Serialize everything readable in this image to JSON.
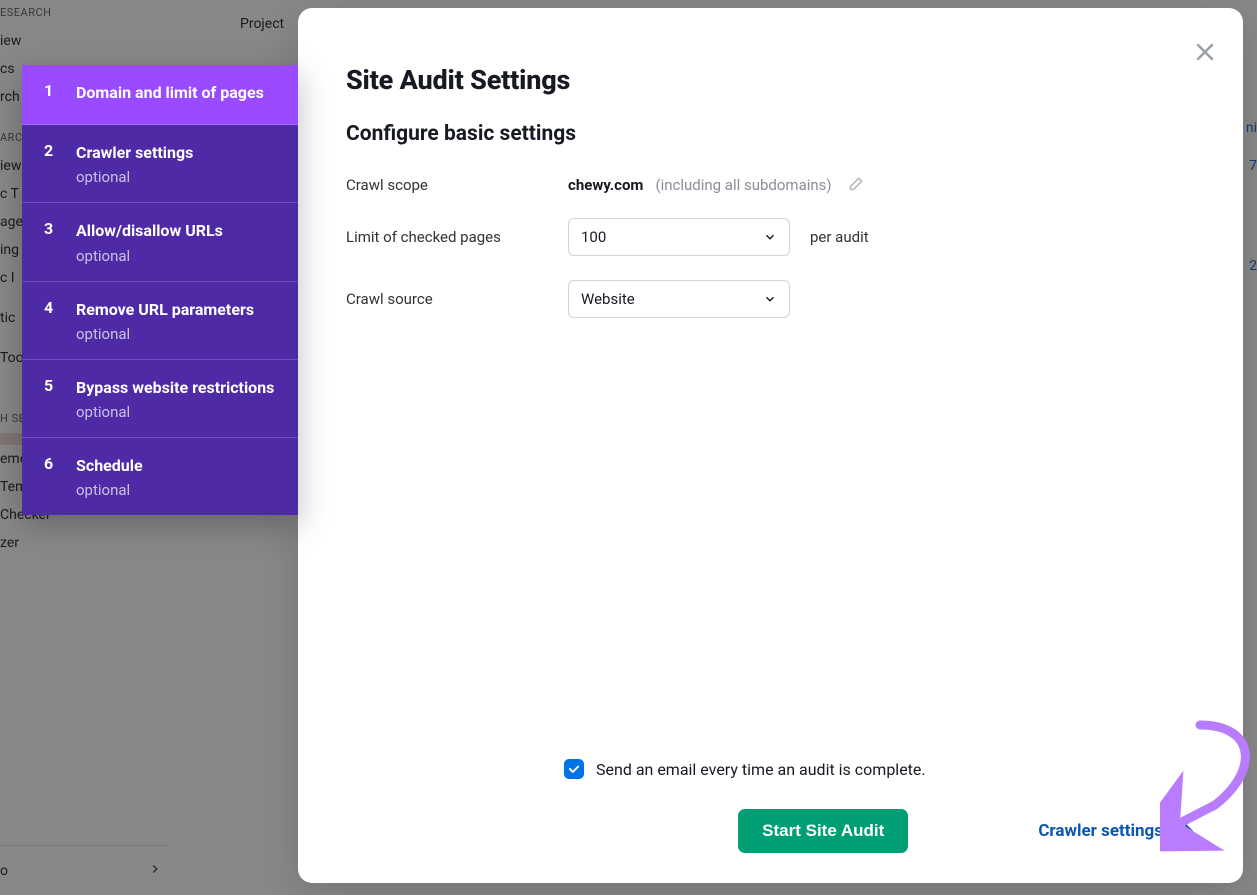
{
  "background": {
    "tab": "Project",
    "nav_header1": "ESEARCH",
    "nav_items1": [
      "iew",
      "cs",
      "rch"
    ],
    "nav_header2": "ARC",
    "nav_items2": [
      "iew",
      "c T",
      "age",
      "ing",
      "c I",
      "",
      "tic",
      "",
      "Too"
    ],
    "nav_header3": "H SEO",
    "nav_items3_active": "",
    "nav_items3": [
      "ement",
      "Template",
      "Checker",
      "zer"
    ],
    "footer_left": "o",
    "right_vals": [
      "ni",
      "7",
      "2"
    ]
  },
  "steps": [
    {
      "num": "1",
      "title": "Domain and limit of pages",
      "optional": "",
      "active": true
    },
    {
      "num": "2",
      "title": "Crawler settings",
      "optional": "optional",
      "active": false
    },
    {
      "num": "3",
      "title": "Allow/disallow URLs",
      "optional": "optional",
      "active": false
    },
    {
      "num": "4",
      "title": "Remove URL parameters",
      "optional": "optional",
      "active": false
    },
    {
      "num": "5",
      "title": "Bypass website restrictions",
      "optional": "optional",
      "active": false
    },
    {
      "num": "6",
      "title": "Schedule",
      "optional": "optional",
      "active": false
    }
  ],
  "modal": {
    "title": "Site Audit Settings",
    "subtitle": "Configure basic settings",
    "crawl_scope_label": "Crawl scope",
    "crawl_scope_domain": "chewy.com",
    "crawl_scope_note": "(including all subdomains)",
    "limit_label": "Limit of checked pages",
    "limit_value": "100",
    "limit_suffix": "per audit",
    "source_label": "Crawl source",
    "source_value": "Website",
    "email_label": "Send an email every time an audit is complete.",
    "primary_button": "Start Site Audit",
    "next_link": "Crawler settings"
  }
}
